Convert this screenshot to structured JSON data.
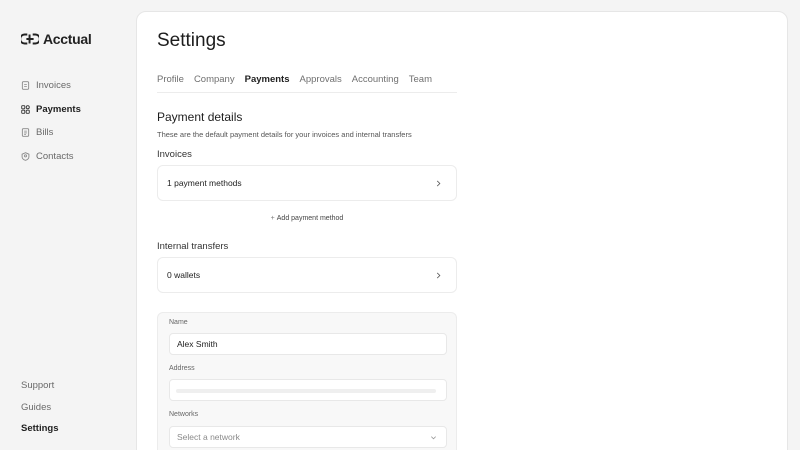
{
  "brand": {
    "name": "Acctual"
  },
  "sidebar": {
    "items": [
      {
        "label": "Invoices",
        "icon": "file-icon"
      },
      {
        "label": "Payments",
        "icon": "grid-icon"
      },
      {
        "label": "Bills",
        "icon": "document-icon"
      },
      {
        "label": "Contacts",
        "icon": "contact-badge-icon"
      }
    ],
    "footer": [
      {
        "label": "Support"
      },
      {
        "label": "Guides"
      },
      {
        "label": "Settings"
      }
    ]
  },
  "page": {
    "title": "Settings",
    "tabs": [
      {
        "label": "Profile"
      },
      {
        "label": "Company"
      },
      {
        "label": "Payments"
      },
      {
        "label": "Approvals"
      },
      {
        "label": "Accounting"
      },
      {
        "label": "Team"
      }
    ],
    "active_tab": "Payments"
  },
  "payment_details": {
    "title": "Payment details",
    "description": "These are the default payment details for your invoices and internal transfers",
    "invoices_label": "Invoices",
    "invoices_summary": "1 payment methods",
    "add_method_label": "Add payment method",
    "internal_label": "Internal transfers",
    "internal_summary": "0 wallets"
  },
  "form": {
    "name_label": "Name",
    "name_value": "Alex Smith",
    "address_label": "Address",
    "networks_label": "Networks",
    "networks_placeholder": "Select a network"
  }
}
